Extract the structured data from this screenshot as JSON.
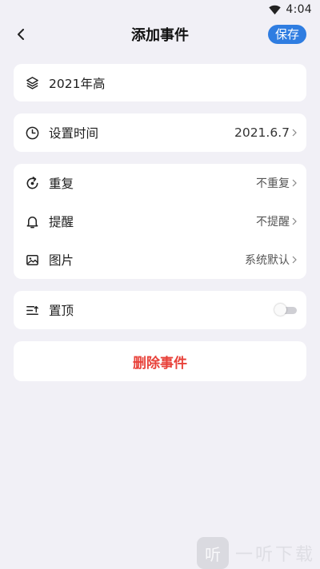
{
  "status_bar": {
    "time": "4:04",
    "wifi_icon": "wifi-icon"
  },
  "header": {
    "title": "添加事件",
    "save_label": "保存",
    "back_icon": "chevron-left-icon"
  },
  "name_card": {
    "icon": "layers-icon",
    "value": "2021年高"
  },
  "time_card": {
    "icon": "clock-icon",
    "label": "设置时间",
    "value": "2021.6.7"
  },
  "options": [
    {
      "icon": "repeat-icon",
      "label": "重复",
      "value": "不重复"
    },
    {
      "icon": "bell-icon",
      "label": "提醒",
      "value": "不提醒"
    },
    {
      "icon": "image-icon",
      "label": "图片",
      "value": "系统默认"
    }
  ],
  "pin_card": {
    "icon": "pin-top-icon",
    "label": "置顶",
    "toggle_on": false
  },
  "delete_label": "删除事件",
  "watermark": {
    "logo_text": "听",
    "brand_text": "一听下载"
  },
  "colors": {
    "accent": "#2f7de1",
    "danger": "#e8423a",
    "background": "#f1f0f6"
  }
}
